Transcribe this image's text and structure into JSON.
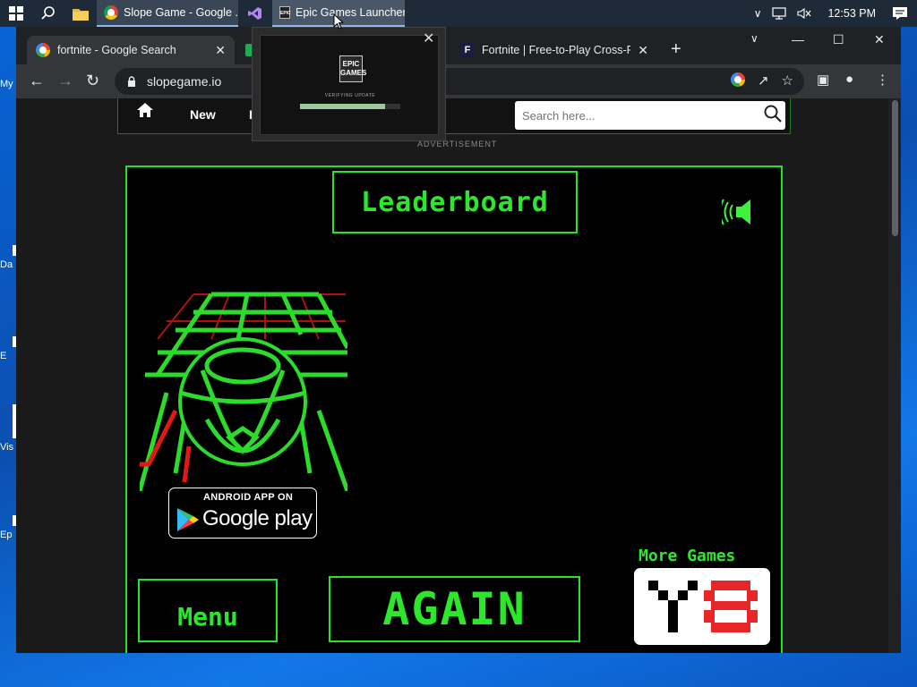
{
  "desktop": {
    "icons": [
      {
        "label": "My"
      },
      {
        "label": "Da"
      },
      {
        "label": "E"
      },
      {
        "label": "Vis"
      },
      {
        "label": "Ep"
      }
    ]
  },
  "taskbar": {
    "apps": [
      {
        "label": "Slope Game - Google ...",
        "icon": "chrome-icon"
      },
      {
        "label": "",
        "icon": "visual-studio-icon"
      },
      {
        "label": "Epic Games Launcher",
        "icon": "epic-games-icon"
      }
    ],
    "clock": "12:53 PM"
  },
  "thumbnail": {
    "logo_text": "EPIC GAMES",
    "status": "VERIFYING UPDATE",
    "progress": 0.85
  },
  "browser": {
    "tabs": [
      {
        "title": "fortnite - Google Search",
        "active": true
      },
      {
        "title": "",
        "active": false
      },
      {
        "title": "Fortnite | Free-to-Play Cross-Plat",
        "active": false
      }
    ],
    "url": "slopegame.io"
  },
  "site": {
    "nav": {
      "new": "New",
      "hi": "Hi"
    },
    "search_placeholder": "Search here...",
    "advertisement": "ADVERTISEMENT"
  },
  "game": {
    "leaderboard": "Leaderboard",
    "google_play_top": "ANDROID APP ON",
    "google_play_bottom": "Google play",
    "more_games": "More Games",
    "menu": "Menu",
    "again": "AGAIN"
  },
  "colors": {
    "neon_green": "#23e623",
    "taskbar": "#1e2a38",
    "browser_bg": "#202124"
  }
}
